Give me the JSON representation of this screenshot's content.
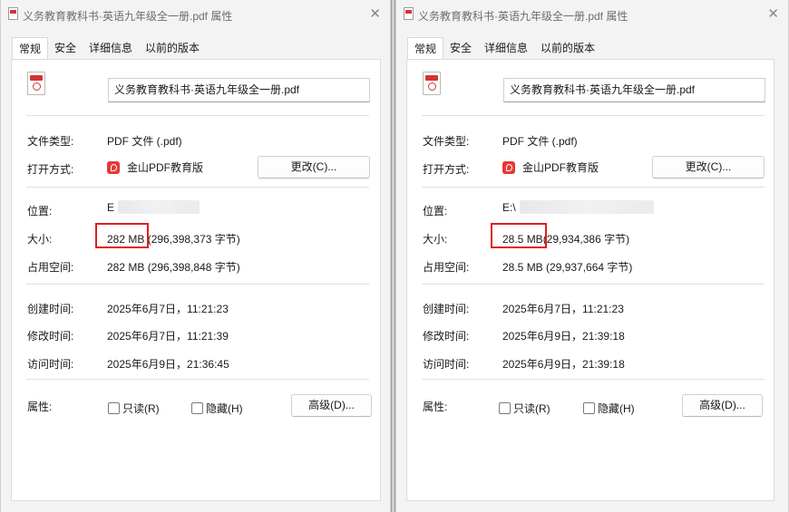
{
  "windows": [
    {
      "title": "义务教育教科书·英语九年级全一册.pdf 属性",
      "tabs": [
        "常规",
        "安全",
        "详细信息",
        "以前的版本"
      ],
      "filename": "义务教育教科书·英语九年级全一册.pdf",
      "labels": {
        "type": "文件类型:",
        "opens_with": "打开方式:",
        "location": "位置:",
        "size": "大小:",
        "size_on_disk": "占用空间:",
        "created": "创建时间:",
        "modified": "修改时间:",
        "accessed": "访问时间:",
        "attributes": "属性:"
      },
      "values": {
        "type": "PDF 文件 (.pdf)",
        "opens_with_app": "金山PDF教育版",
        "location_prefix": "E",
        "size_main": "282 MB",
        "size_bytes": "(296,398,373 字节)",
        "size_on_disk": "282 MB (296,398,848 字节)",
        "created": "2025年6月7日，11:21:23",
        "modified": "2025年6月7日，11:21:39",
        "accessed": "2025年6月9日，21:36:45"
      },
      "buttons": {
        "change": "更改(C)...",
        "advanced": "高级(D)..."
      },
      "checkboxes": {
        "readonly": "只读(R)",
        "hidden": "隐藏(H)"
      },
      "close_glyph": "✕"
    },
    {
      "title": "义务教育教科书·英语九年级全一册.pdf 属性",
      "tabs": [
        "常规",
        "安全",
        "详细信息",
        "以前的版本"
      ],
      "filename": "义务教育教科书·英语九年级全一册.pdf",
      "labels": {
        "type": "文件类型:",
        "opens_with": "打开方式:",
        "location": "位置:",
        "size": "大小:",
        "size_on_disk": "占用空间:",
        "created": "创建时间:",
        "modified": "修改时间:",
        "accessed": "访问时间:",
        "attributes": "属性:"
      },
      "values": {
        "type": "PDF 文件 (.pdf)",
        "opens_with_app": "金山PDF教育版",
        "location_prefix": "E:\\",
        "size_main": "28.5 MB",
        "size_bytes": "(29,934,386 字节)",
        "size_on_disk": "28.5 MB (29,937,664 字节)",
        "created": "2025年6月7日，11:21:23",
        "modified": "2025年6月9日，21:39:18",
        "accessed": "2025年6月9日，21:39:18"
      },
      "buttons": {
        "change": "更改(C)...",
        "advanced": "高级(D)..."
      },
      "checkboxes": {
        "readonly": "只读(R)",
        "hidden": "隐藏(H)"
      },
      "close_glyph": "✕"
    }
  ],
  "colors": {
    "highlight": "#e01e1e",
    "pdf_red": "#d13438",
    "app_red": "#e53935"
  }
}
